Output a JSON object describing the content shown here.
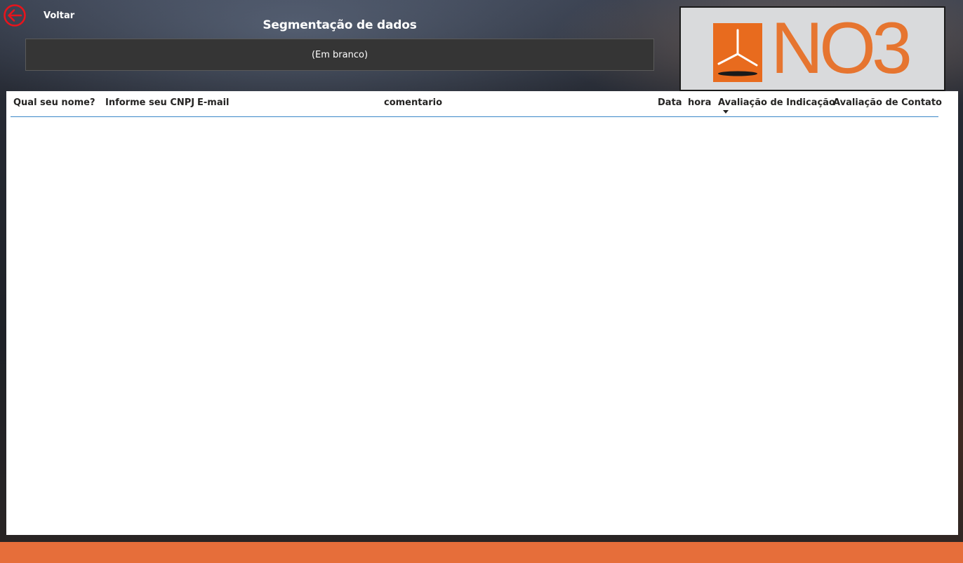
{
  "nav": {
    "back_label": "Voltar",
    "back_icon": "arrow-left-circle-icon",
    "back_icon_color": "#e8141c"
  },
  "slicer": {
    "title": "Segmentação de dados",
    "selected_value": "(Em branco)"
  },
  "logo": {
    "text": "NO3",
    "icon": "wind-turbine-icon",
    "brand_color": "#e86b1e"
  },
  "table": {
    "columns": [
      "Qual seu nome?",
      "Informe seu CNPJ",
      "E-mail",
      "comentario",
      "Data",
      "hora",
      "Avaliação de Indicação",
      "Avaliação de Contato"
    ],
    "sorted_column": "Avaliação de Indicação",
    "sort_direction": "descending",
    "rows": []
  },
  "colors": {
    "header_divider": "#3b88c8",
    "footer_bar": "#e66e3a",
    "slicer_background": "#353535"
  }
}
